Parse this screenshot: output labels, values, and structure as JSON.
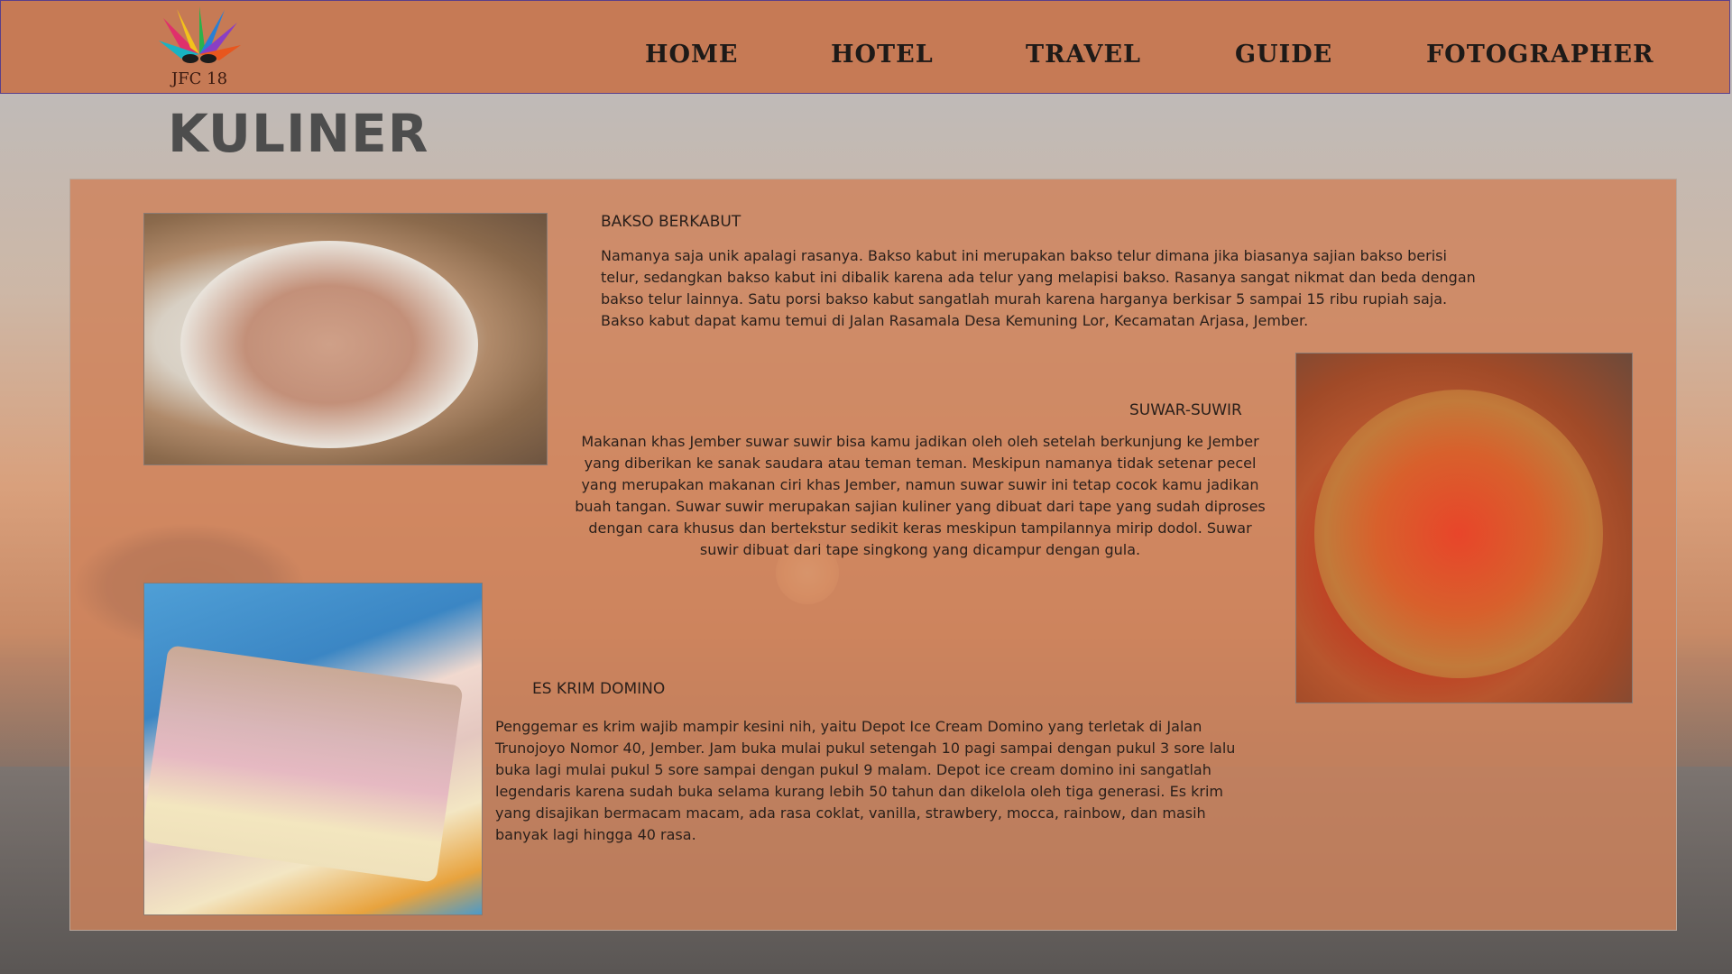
{
  "header": {
    "logo_text": "JFC 18",
    "nav": [
      "HOME",
      "HOTEL",
      "TRAVEL",
      "GUIDE",
      "FOTOGRAPHER"
    ]
  },
  "page_title": "KULINER",
  "items": [
    {
      "title": "BAKSO BERKABUT",
      "text": "Namanya saja unik apalagi rasanya. Bakso kabut ini merupakan bakso telur dimana jika biasanya sajian bakso berisi telur, sedangkan bakso kabut ini dibalik karena ada telur yang melapisi bakso. Rasanya sangat nikmat dan beda dengan bakso telur lainnya. Satu porsi bakso kabut sangatlah murah karena harganya berkisar 5 sampai 15 ribu rupiah saja. Bakso kabut dapat kamu temui di Jalan Rasamala Desa Kemuning Lor, Kecamatan Arjasa, Jember.",
      "image": "bakso-photo"
    },
    {
      "title": "SUWAR-SUWIR",
      "text": "Makanan khas Jember suwar suwir bisa kamu jadikan oleh oleh setelah berkunjung ke Jember yang diberikan ke sanak saudara atau teman teman. Meskipun namanya tidak setenar pecel yang merupakan makanan ciri khas Jember, namun suwar suwir ini tetap cocok kamu jadikan buah tangan. Suwar suwir merupakan sajian kuliner yang dibuat dari tape yang sudah diproses dengan cara khusus dan bertekstur sedikit keras meskipun tampilannya mirip dodol. Suwar suwir dibuat dari tape singkong yang dicampur dengan gula.",
      "image": "suwar-suwir-photo"
    },
    {
      "title": "ES KRIM DOMINO",
      "text": "Penggemar es krim wajib mampir kesini nih, yaitu Depot Ice Cream Domino yang terletak di Jalan Trunojoyo Nomor 40, Jember. Jam buka mulai pukul setengah 10 pagi sampai dengan pukul 3 sore lalu buka lagi mulai pukul 5 sore sampai dengan pukul 9 malam. Depot ice cream domino ini sangatlah legendaris karena sudah buka selama kurang lebih 50 tahun dan dikelola oleh tiga generasi. Es krim yang disajikan bermacam macam, ada rasa coklat, vanilla, strawbery, mocca, rainbow, dan masih banyak lagi hingga 40 rasa.",
      "image": "es-krim-photo"
    }
  ],
  "colors": {
    "header_bg": "#c67a55",
    "panel_bg": "#ce825c",
    "title": "#4d4d4d"
  }
}
